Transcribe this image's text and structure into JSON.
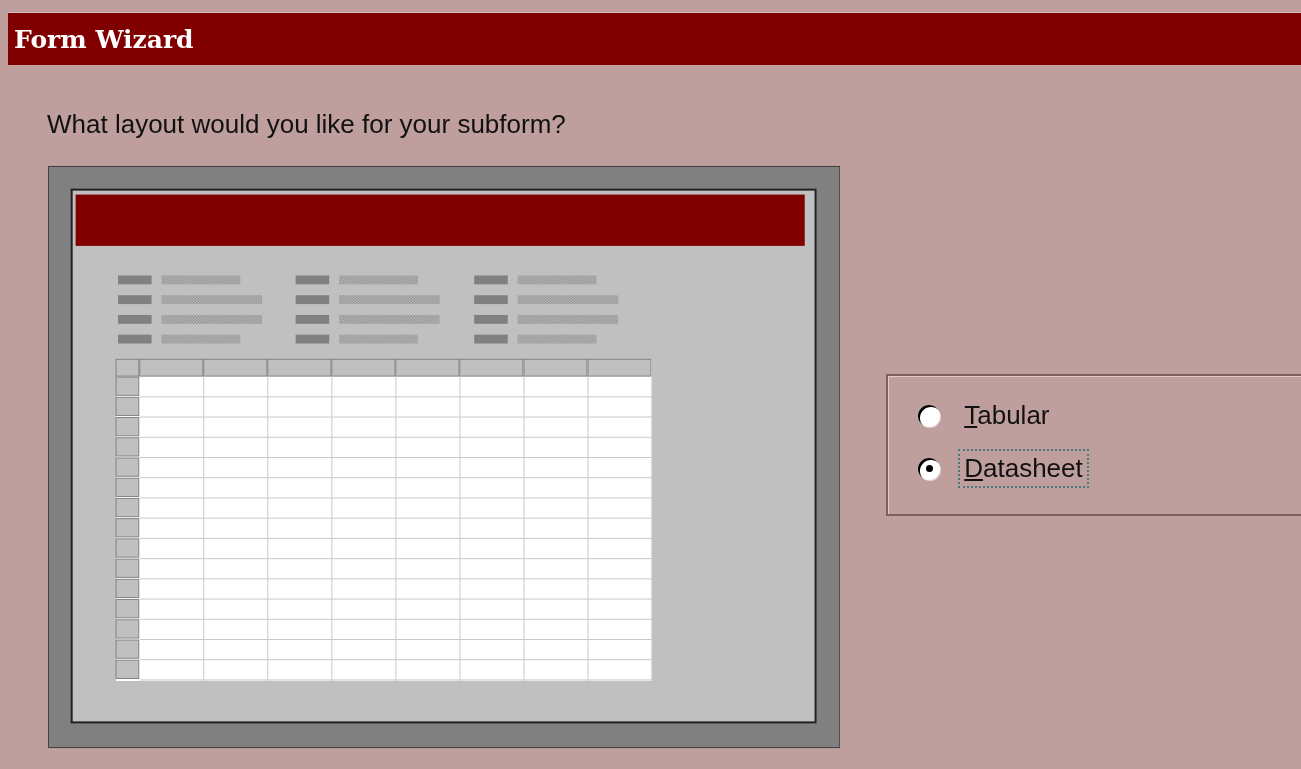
{
  "window": {
    "title": "Form Wizard"
  },
  "question": "What layout would you like for your subform?",
  "layouts": [
    {
      "label": "Tabular",
      "selected": false,
      "focused": false
    },
    {
      "label": "Datasheet",
      "selected": true,
      "focused": true
    }
  ]
}
